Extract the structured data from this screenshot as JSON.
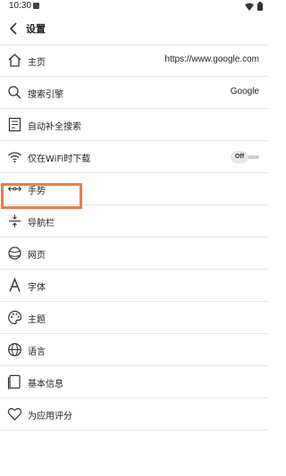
{
  "status_bar": {
    "time": "10:30"
  },
  "header": {
    "title": "设置"
  },
  "settings": {
    "items": [
      {
        "label": "主页",
        "value": "https://www.google.com"
      },
      {
        "label": "搜索引擎",
        "value": "Google"
      },
      {
        "label": "自动补全搜索"
      },
      {
        "label": "仅在WiFi时下载",
        "toggle_text": "Off"
      },
      {
        "label": "手势"
      },
      {
        "label": "导航栏"
      },
      {
        "label": "网页"
      },
      {
        "label": "字体"
      },
      {
        "label": "主题"
      },
      {
        "label": "语言"
      },
      {
        "label": "基本信息"
      },
      {
        "label": "为应用评分"
      }
    ]
  },
  "colors": {
    "highlight": "#f07a4a",
    "divider": "#e8e8e8",
    "text": "#222222"
  }
}
